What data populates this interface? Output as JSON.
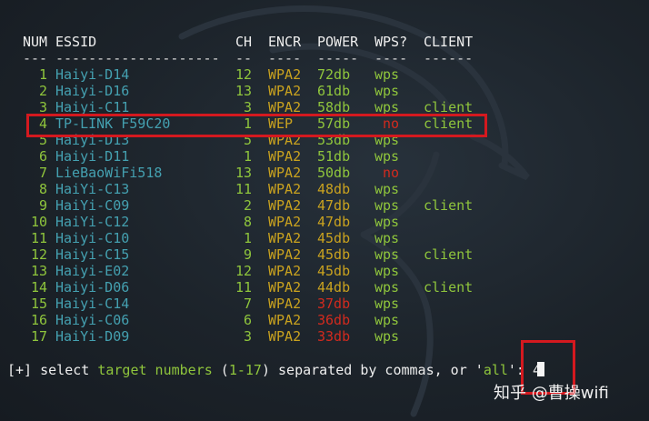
{
  "colors": {
    "background": "#1d252d",
    "green": "#8fc53c",
    "cyan": "#44a0b0",
    "yellow": "#c9a21f",
    "red": "#d22a1e",
    "highlight": "#d4191f"
  },
  "header": {
    "num": "NUM",
    "essid": "ESSID",
    "ch": "CH",
    "encr": "ENCR",
    "power": "POWER",
    "wps": "WPS?",
    "client": "CLIENT"
  },
  "separator": {
    "num": "---",
    "essid": "--------------------",
    "ch": "--",
    "encr": "----",
    "power": "-----",
    "wps": "----",
    "client": "------"
  },
  "networks": [
    {
      "num": "1",
      "essid": "Haiyi-D14",
      "ch": "12",
      "encr": "WPA2",
      "power": "72db",
      "power_level": "high",
      "wps": "wps",
      "client": ""
    },
    {
      "num": "2",
      "essid": "Haiyi-D16",
      "ch": "13",
      "encr": "WPA2",
      "power": "61db",
      "power_level": "high",
      "wps": "wps",
      "client": ""
    },
    {
      "num": "3",
      "essid": "Haiyi-C11",
      "ch": "3",
      "encr": "WPA2",
      "power": "58db",
      "power_level": "high",
      "wps": "wps",
      "client": "client"
    },
    {
      "num": "4",
      "essid": "TP-LINK F59C20",
      "ch": "1",
      "encr": "WEP",
      "power": "57db",
      "power_level": "high",
      "wps": "no",
      "client": "client"
    },
    {
      "num": "5",
      "essid": "Haiyi-D13",
      "ch": "5",
      "encr": "WPA2",
      "power": "53db",
      "power_level": "high",
      "wps": "wps",
      "client": ""
    },
    {
      "num": "6",
      "essid": "Haiyi-D11",
      "ch": "1",
      "encr": "WPA2",
      "power": "51db",
      "power_level": "high",
      "wps": "wps",
      "client": ""
    },
    {
      "num": "7",
      "essid": "LieBaoWiFi518",
      "ch": "13",
      "encr": "WPA2",
      "power": "50db",
      "power_level": "high",
      "wps": "no",
      "client": ""
    },
    {
      "num": "8",
      "essid": "HaiYi-C13",
      "ch": "11",
      "encr": "WPA2",
      "power": "48db",
      "power_level": "mid",
      "wps": "wps",
      "client": ""
    },
    {
      "num": "9",
      "essid": "HaiYi-C09",
      "ch": "2",
      "encr": "WPA2",
      "power": "47db",
      "power_level": "mid",
      "wps": "wps",
      "client": "client"
    },
    {
      "num": "10",
      "essid": "HaiYi-C12",
      "ch": "8",
      "encr": "WPA2",
      "power": "47db",
      "power_level": "mid",
      "wps": "wps",
      "client": ""
    },
    {
      "num": "11",
      "essid": "Haiyi-C10",
      "ch": "1",
      "encr": "WPA2",
      "power": "45db",
      "power_level": "mid",
      "wps": "wps",
      "client": ""
    },
    {
      "num": "12",
      "essid": "Haiyi-C15",
      "ch": "9",
      "encr": "WPA2",
      "power": "45db",
      "power_level": "mid",
      "wps": "wps",
      "client": "client"
    },
    {
      "num": "13",
      "essid": "Haiyi-E02",
      "ch": "12",
      "encr": "WPA2",
      "power": "45db",
      "power_level": "mid",
      "wps": "wps",
      "client": ""
    },
    {
      "num": "14",
      "essid": "Haiyi-D06",
      "ch": "11",
      "encr": "WPA2",
      "power": "44db",
      "power_level": "mid",
      "wps": "wps",
      "client": "client"
    },
    {
      "num": "15",
      "essid": "Haiyi-C14",
      "ch": "7",
      "encr": "WPA2",
      "power": "37db",
      "power_level": "low",
      "wps": "wps",
      "client": ""
    },
    {
      "num": "16",
      "essid": "Haiyi-C06",
      "ch": "6",
      "encr": "WPA2",
      "power": "36db",
      "power_level": "low",
      "wps": "wps",
      "client": ""
    },
    {
      "num": "17",
      "essid": "HaiYi-D09",
      "ch": "3",
      "encr": "WPA2",
      "power": "33db",
      "power_level": "low",
      "wps": "wps",
      "client": ""
    }
  ],
  "prompt": {
    "prefix": "[+] select ",
    "target": "target numbers",
    "open_paren": " (",
    "range": "1-17",
    "mid": ") separated by commas, or '",
    "all": "all",
    "end": "': ",
    "input": "4"
  },
  "watermark": "知乎 @曹操wifi"
}
